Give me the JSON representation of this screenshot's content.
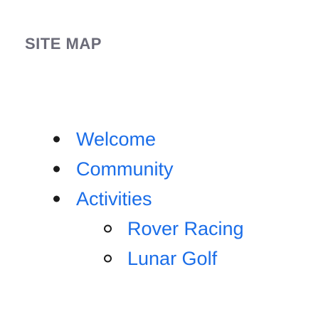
{
  "heading": "SITE MAP",
  "links": {
    "welcome": "Welcome",
    "community": "Community",
    "activities": "Activities",
    "rover_racing": "Rover Racing",
    "lunar_golf": "Lunar Golf"
  },
  "colors": {
    "link": "#1a6de8",
    "heading": "#6b6b78",
    "bullet": "#1c1c1c"
  }
}
